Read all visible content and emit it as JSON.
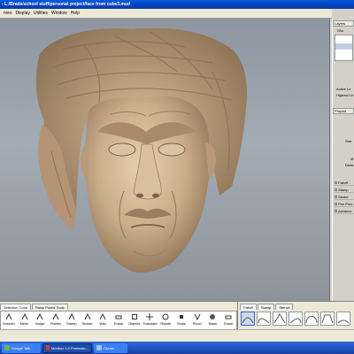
{
  "window": {
    "title": "- L:/Brads/school stuff/personal project/face from cube3.mud"
  },
  "menu": {
    "items": [
      "rves",
      "Display",
      "Utilities",
      "Window",
      "Help"
    ]
  },
  "right_panel": {
    "layers_tab": "Layers",
    "show_label": "Sho",
    "active_level": "Active Le",
    "highest_level": "Highest Le",
    "properties_tab": "Propert",
    "strength": "Stre",
    "m_label": "M",
    "dist_label": "Dista",
    "sections": [
      "Falloff",
      "Stamp",
      "Stroke",
      "Pen Pres",
      "Advance"
    ]
  },
  "bottom_panel": {
    "tabs": [
      "Selection Tools",
      "Raise Points Tools"
    ],
    "tools": [
      "Smooth",
      "Mesh",
      "Bulge",
      "Flatten",
      "Stamp",
      "Smear",
      "Wax",
      "Erase",
      "Objects",
      "Translate",
      "Rotate",
      "Scale",
      "Pinch",
      "Mask",
      "Erase"
    ]
  },
  "falloff_panel": {
    "tabs": [
      "Falloff",
      "Stamp",
      "Stencil"
    ]
  },
  "taskbar": {
    "items": [
      "Google Talk",
      "Mudbox 1.0 Professio...",
      "iTunes"
    ]
  },
  "colors": {
    "title_bar": "#0442b8",
    "viewport_bg": "#a3abb4",
    "model_clay": "#c9ad8a",
    "taskbar": "#2456c8"
  }
}
